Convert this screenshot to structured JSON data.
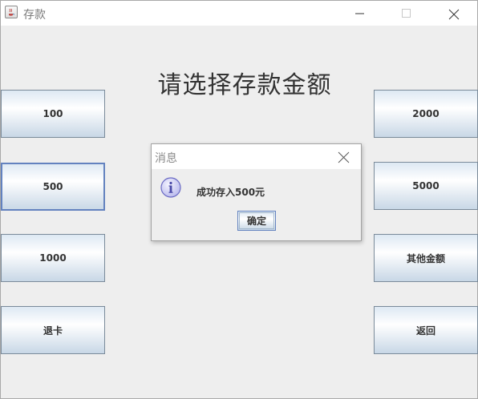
{
  "window": {
    "title": "存款",
    "icon": "java-cup-icon"
  },
  "heading": "请选择存款金额",
  "buttons": {
    "left": [
      "100",
      "500",
      "1000",
      "退卡"
    ],
    "right": [
      "2000",
      "5000",
      "其他金额",
      "返回"
    ]
  },
  "dialog": {
    "title": "消息",
    "message": "成功存入500元",
    "ok_label": "确定",
    "icon": "info-icon"
  },
  "colors": {
    "button_gradient_top": "#dde8f3",
    "button_gradient_bottom": "#c8d7e6",
    "focus_border": "#6382bf",
    "info_icon": "#8080d0"
  }
}
